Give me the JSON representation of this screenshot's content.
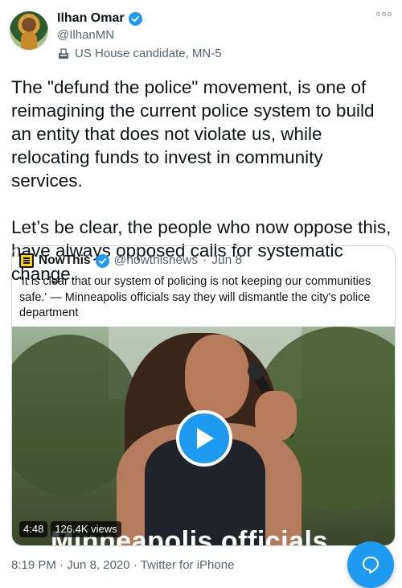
{
  "author": {
    "name": "Ilhan Omar",
    "handle": "@IlhanMN",
    "label": "US House candidate, MN-5",
    "verified": true
  },
  "tweet": {
    "paragraph1": "The \"defund the police\" movement, is one of reimagining the current police system to build an entity that does not violate us, while relocating funds to invest in community services.",
    "paragraph2": "Let’s be clear, the people who now oppose this, have always opposed calls for systematic change."
  },
  "quoted": {
    "name": "NowThis",
    "handle": "@nowthisnews",
    "separator": "·",
    "date": "Jun 8",
    "text": "'It is clear that our system of policing is not keeping our communities safe.' — Minneapolis officials say they will dismantle the city's police department",
    "video": {
      "duration": "4:48",
      "views": "126.4K views",
      "caption": "Minneapolis officials"
    }
  },
  "footer": {
    "time": "8:19 PM",
    "separator": "·",
    "date": "Jun 8, 2020",
    "source": "Twitter for iPhone"
  },
  "colors": {
    "accent": "#1d9bf0",
    "text": "#0f1419",
    "secondary": "#536471",
    "border": "#cfd9de"
  },
  "icons": [
    "verified-badge-icon",
    "more-options-icon",
    "ballot-box-icon",
    "nowthis-logo",
    "play-icon",
    "compose-reply-icon"
  ]
}
